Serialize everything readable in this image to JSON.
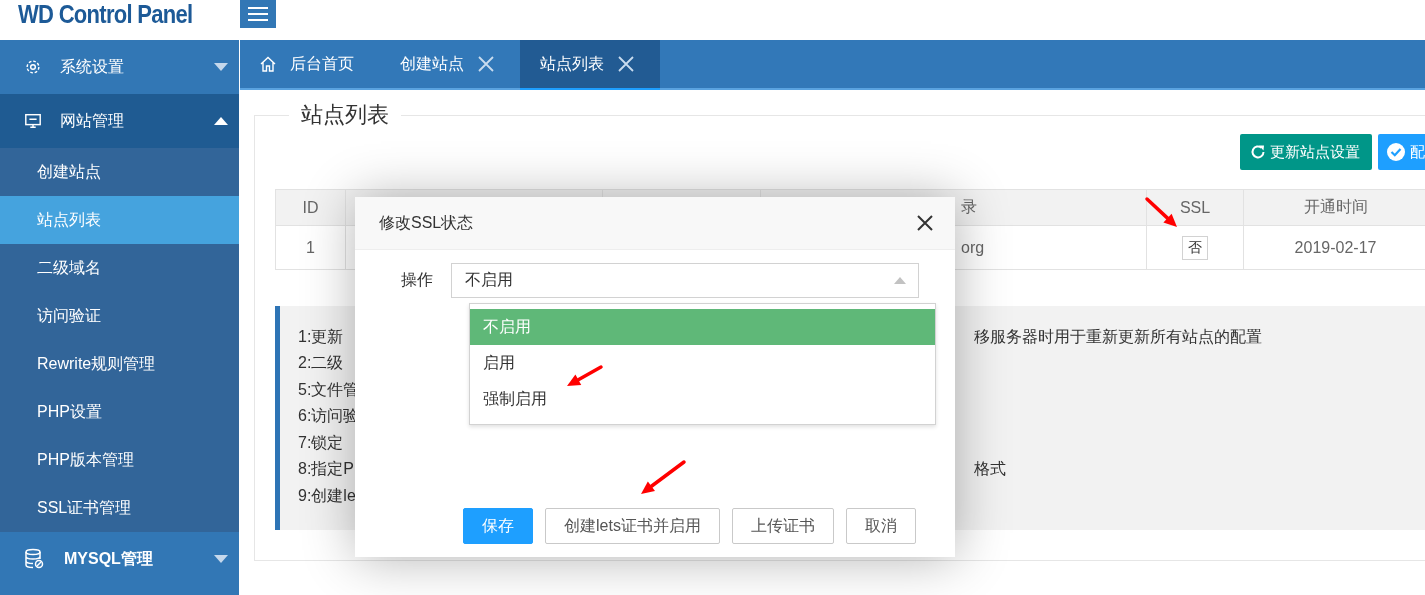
{
  "header": {
    "logo": "WD Control Panel"
  },
  "sidebar": {
    "groups": [
      {
        "label": "系统设置",
        "kind": "settings",
        "expanded": false
      },
      {
        "label": "网站管理",
        "kind": "monitor",
        "expanded": true,
        "children": [
          {
            "label": "创建站点",
            "selected": false
          },
          {
            "label": "站点列表",
            "selected": true
          },
          {
            "label": "二级域名",
            "selected": false
          },
          {
            "label": "访问验证",
            "selected": false
          },
          {
            "label": "Rewrite规则管理",
            "selected": false
          },
          {
            "label": "PHP设置",
            "selected": false
          },
          {
            "label": "PHP版本管理",
            "selected": false
          },
          {
            "label": "SSL证书管理",
            "selected": false
          }
        ]
      },
      {
        "label": "MYSQL管理",
        "kind": "database",
        "expanded": false
      }
    ]
  },
  "tabs": [
    {
      "label": "后台首页",
      "kind": "home",
      "selected": false
    },
    {
      "label": "创建站点",
      "kind": "page",
      "selected": false
    },
    {
      "label": "站点列表",
      "kind": "page",
      "selected": true
    }
  ],
  "page": {
    "legend": "站点列表",
    "toolbar": [
      {
        "label": "更新站点设置",
        "kind": "refresh"
      },
      {
        "label": "配",
        "kind": "check"
      }
    ],
    "table": {
      "columns": [
        "ID",
        null,
        null,
        "录",
        "SSL",
        "开通时间"
      ],
      "rows": [
        {
          "cells": [
            "1",
            null,
            null,
            "org",
            "否",
            "2019-02-17"
          ]
        }
      ]
    },
    "notes": [
      {
        "left": "1:更新",
        "right": "移服务器时用于重新更新所有站点的配置"
      },
      {
        "left": "2:二级"
      },
      {
        "left": "5:文件管"
      },
      {
        "left": "6:访问验"
      },
      {
        "left": "7:锁定"
      },
      {
        "left": "8:指定P",
        "right": "格式"
      },
      {
        "left": "9:创建le"
      }
    ]
  },
  "dialog": {
    "title": "修改SSL状态",
    "field": {
      "label": "操作",
      "value": "不启用",
      "expanded": true
    },
    "options": [
      {
        "label": "不启用",
        "selected": true
      },
      {
        "label": "启用",
        "selected": false
      },
      {
        "label": "强制启用",
        "selected": false
      }
    ],
    "buttons": [
      {
        "label": "保存",
        "kind": "primary"
      },
      {
        "label": "创建lets证书并启用",
        "kind": "default"
      },
      {
        "label": "上传证书",
        "kind": "default"
      },
      {
        "label": "取消",
        "kind": "default"
      }
    ]
  }
}
